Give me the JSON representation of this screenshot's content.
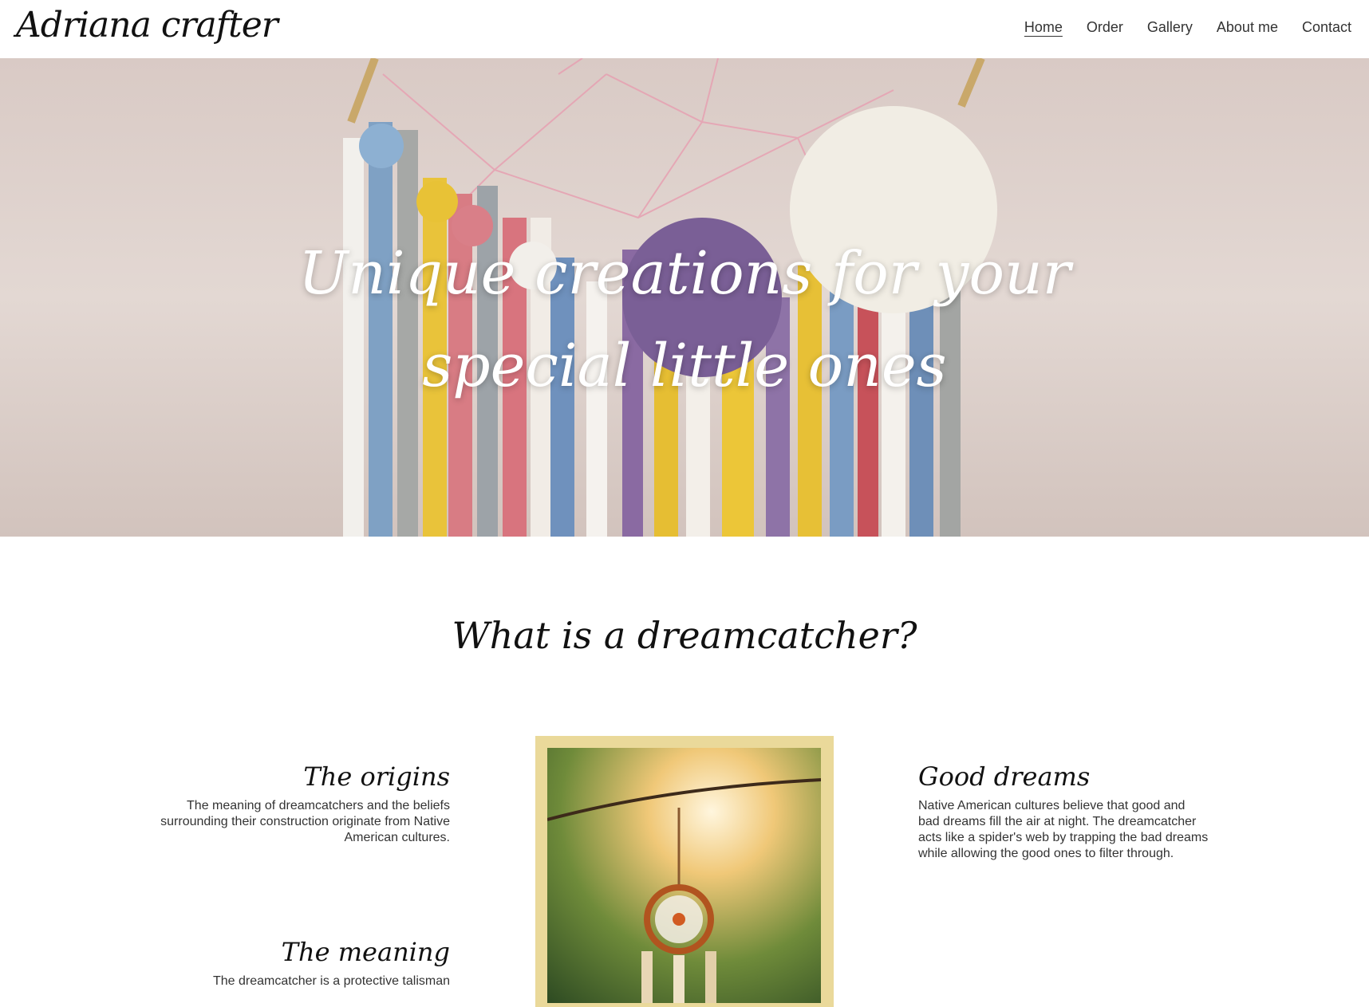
{
  "header": {
    "logo": "Adriana crafter",
    "nav": [
      "Home",
      "Order",
      "Gallery",
      "About me",
      "Contact"
    ],
    "active_nav": "Home"
  },
  "hero": {
    "title": "Unique creations for your special little ones"
  },
  "section": {
    "title": "What is a dreamcatcher?",
    "items_left": [
      {
        "title": "The origins",
        "text": "The meaning of dreamcatchers and the beliefs surrounding their construction originate from Native American cultures."
      },
      {
        "title": "The meaning",
        "text": "The dreamcatcher is a protective talisman"
      }
    ],
    "items_right": [
      {
        "title": "Good dreams",
        "text": "Native American cultures believe that good and bad dreams fill the air at night. The dreamcatcher acts like a spider's web by trapping the bad dreams while allowing the good ones to filter through."
      }
    ]
  },
  "colors": {
    "frame": "#ead99a",
    "hero_bg": "#ddd0cb",
    "text": "#222222"
  }
}
